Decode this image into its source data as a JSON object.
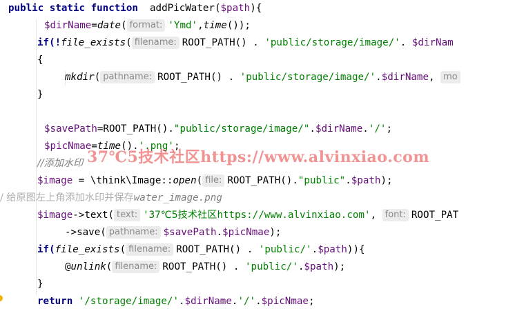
{
  "code": {
    "l1": [
      "public static function",
      "addPicWater(",
      "$path",
      "){"
    ],
    "l2": [
      "$dirName",
      "=",
      "date",
      "(",
      "format:",
      "'Ymd'",
      ",",
      "time",
      "());"
    ],
    "l3": [
      "if(!",
      "file_exists",
      "(",
      "filename:",
      "ROOT_PATH()",
      " . ",
      "'public/storage/image/'",
      ". ",
      "$dirNam"
    ],
    "l4": [
      "{"
    ],
    "l5": [
      "mkdir",
      "(",
      "pathname:",
      "ROOT_PATH()",
      " . ",
      "'public/storage/image/'",
      ".",
      "$dirName",
      ", ",
      "mo"
    ],
    "l6": [
      "}"
    ],
    "l8": [
      "$savePath",
      "=ROOT_PATH().",
      "\"public/storage/image/\"",
      ".",
      "$dirName",
      ".",
      "'/'",
      ";"
    ],
    "l9": [
      "$picNmae",
      "=",
      "time",
      "().",
      "'.png'",
      ";"
    ],
    "l10": [
      "//添加水印"
    ],
    "l11": [
      "$image",
      " = \\think\\Image::",
      "open",
      "(",
      "file:",
      "ROOT_PATH().",
      "\"public\"",
      ".",
      "$path",
      ");"
    ],
    "l12": [
      "/ 给原图左上角添加水印并保存",
      "water_image.png"
    ],
    "l13": [
      "$image",
      "->text(",
      "text:",
      "'37",
      "℃",
      "5技术社区",
      "https://www.alvinxiao.com'",
      ", ",
      "font:",
      "ROOT_PAT"
    ],
    "l14": [
      "->save(",
      "pathname:",
      "$savePath",
      ".",
      "$picNmae",
      ");"
    ],
    "l15": [
      "if(",
      "file_exists",
      "(",
      "filename:",
      "ROOT_PATH()",
      " . ",
      "'public/'",
      ".",
      "$path",
      ")){"
    ],
    "l16": [
      "@",
      "unlink",
      "(",
      "filename:",
      "ROOT_PATH()",
      " . ",
      "'public/'",
      ".",
      "$path",
      ");"
    ],
    "l17": [
      "}"
    ],
    "l18": [
      "return",
      " '/storage/image/'",
      ".",
      "$dirName",
      ".",
      "'/'",
      ".",
      "$picNmae",
      ";"
    ]
  },
  "watermark": "37℃5技术社区https://www.alvinxiao.com",
  "colors": {
    "keyword": "#000080",
    "variable": "#660e7a",
    "string": "#008000",
    "comment": "#808080",
    "watermark": "#e62828",
    "hint_bg": "#ececec"
  }
}
